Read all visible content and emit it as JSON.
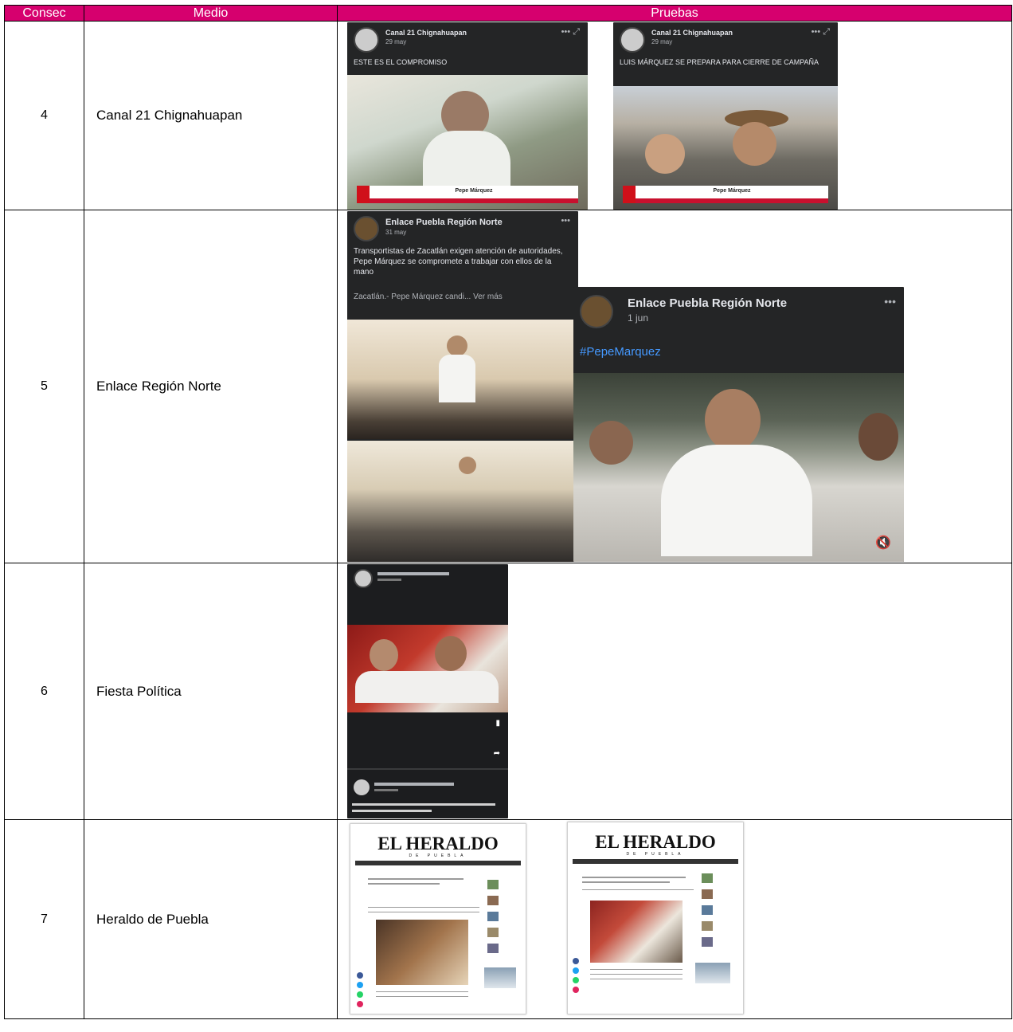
{
  "table": {
    "headers": {
      "consec": "Consec",
      "medio": "Medio",
      "pruebas": "Pruebas"
    },
    "rows": [
      {
        "consec": "4",
        "medio": "Canal 21 Chignahuapan",
        "evidence": [
          {
            "page_name": "Canal 21 Chignahuapan",
            "date": "29 may",
            "caption": "ESTE ES EL COMPROMISO",
            "banner_name": "Pepe Márquez"
          },
          {
            "page_name": "Canal 21 Chignahuapan",
            "date": "29 may",
            "caption": "LUIS MÁRQUEZ SE PREPARA PARA CIERRE DE CAMPAÑA",
            "banner_name": "Pepe Márquez"
          }
        ]
      },
      {
        "consec": "5",
        "medio": "Enlace Región Norte",
        "evidence": [
          {
            "page_name": "Enlace Puebla Región Norte",
            "date": "31 may",
            "caption": "Transportistas de Zacatlán exigen atención de autoridades, Pepe Márquez se compromete a trabajar con ellos de la mano",
            "caption2": "Zacatlán.- Pepe Márquez candi... Ver más"
          },
          {
            "page_name": "Enlace Puebla Región Norte",
            "date": "1 jun",
            "caption": "#PepeMarquez"
          }
        ]
      },
      {
        "consec": "6",
        "medio": "Fiesta Política",
        "evidence": [
          {
            "page_name": "Fiesta Política"
          }
        ]
      },
      {
        "consec": "7",
        "medio": "Heraldo de Puebla",
        "evidence": [
          {
            "logo": "EL HERALDO",
            "logo_sub": "DE PUEBLA"
          },
          {
            "logo": "EL HERALDO",
            "logo_sub": "DE PUEBLA"
          }
        ]
      }
    ]
  },
  "colors": {
    "header_bg": "#d6006e",
    "header_text": "#ffffff",
    "border": "#000000",
    "fb_dark": "#242526",
    "hashtag": "#4599ff",
    "banner_red": "#c8102e"
  }
}
